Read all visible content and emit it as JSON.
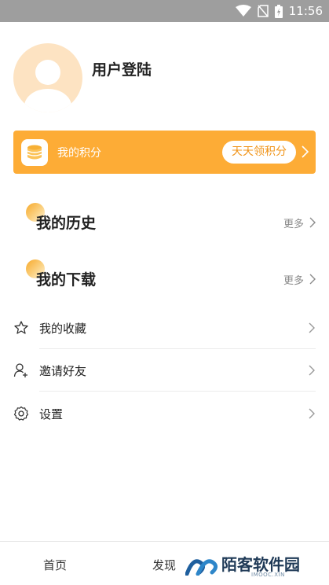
{
  "status_bar": {
    "time": "11:56",
    "icons": [
      "wifi-icon",
      "no-sim-icon",
      "battery-icon"
    ]
  },
  "profile": {
    "login_label": "用户登陆"
  },
  "points": {
    "label": "我的积分",
    "pill_label": "天天领积分",
    "color": "#fdac36"
  },
  "sections": [
    {
      "title": "我的历史",
      "more": "更多"
    },
    {
      "title": "我的下载",
      "more": "更多"
    }
  ],
  "menu": [
    {
      "label": "我的收藏",
      "icon": "star-icon"
    },
    {
      "label": "邀请好友",
      "icon": "add-user-icon"
    },
    {
      "label": "设置",
      "icon": "gear-icon"
    }
  ],
  "bottom_nav": {
    "items": [
      "首页",
      "发现"
    ]
  },
  "watermark": {
    "text": "陌客软件园",
    "sub": "IMOOC.XIN"
  }
}
